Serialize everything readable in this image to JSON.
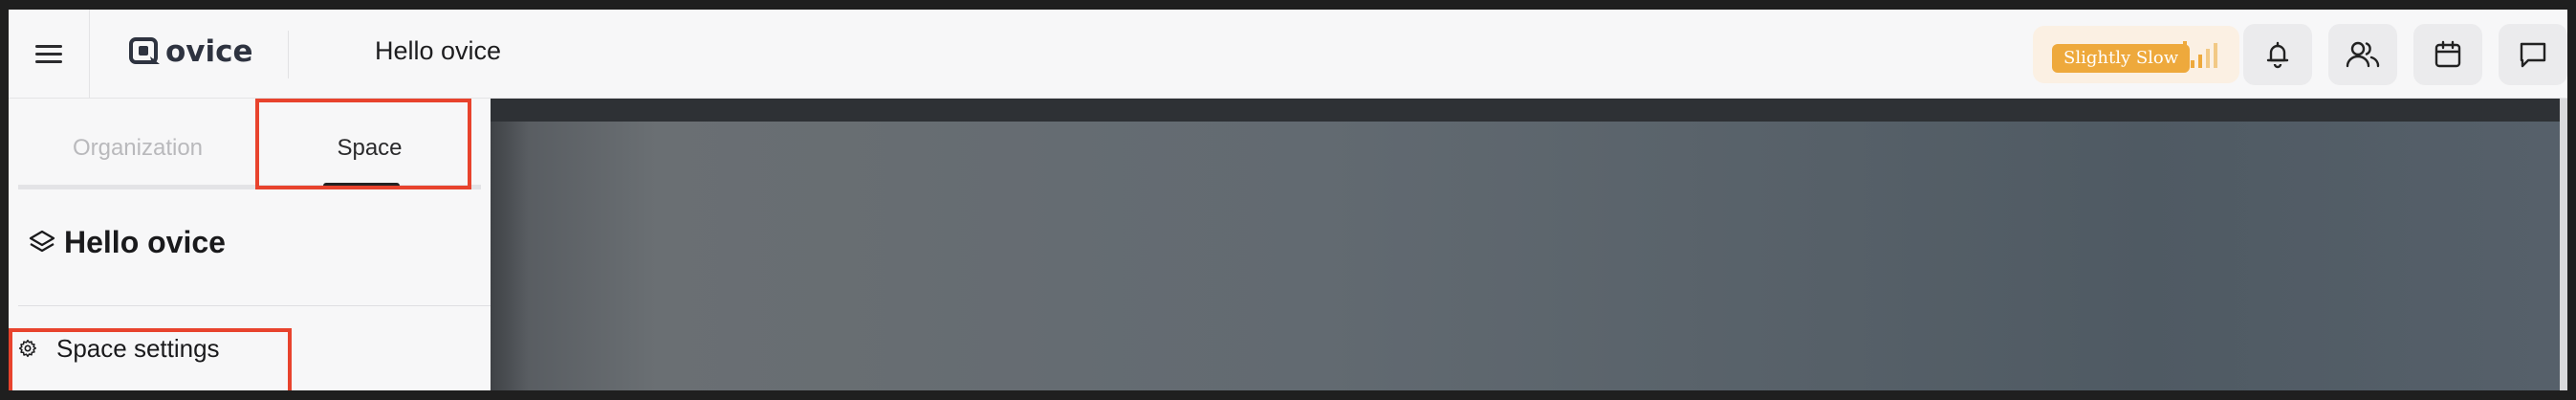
{
  "header": {
    "title": "Hello ovice",
    "logo_text": "ovice",
    "network_status": "Slightly Slow",
    "icons": [
      "menu-icon",
      "bell-icon",
      "users-icon",
      "calendar-icon",
      "chat-icon"
    ]
  },
  "sidebar": {
    "tabs": [
      {
        "label": "Organization",
        "active": false
      },
      {
        "label": "Space",
        "active": true
      }
    ],
    "space_name": "Hello ovice",
    "items": [
      {
        "label": "Space settings",
        "icon": "gear-icon"
      }
    ]
  },
  "colors": {
    "highlight_box": "#e8432d",
    "network_badge": "#eea93c"
  }
}
